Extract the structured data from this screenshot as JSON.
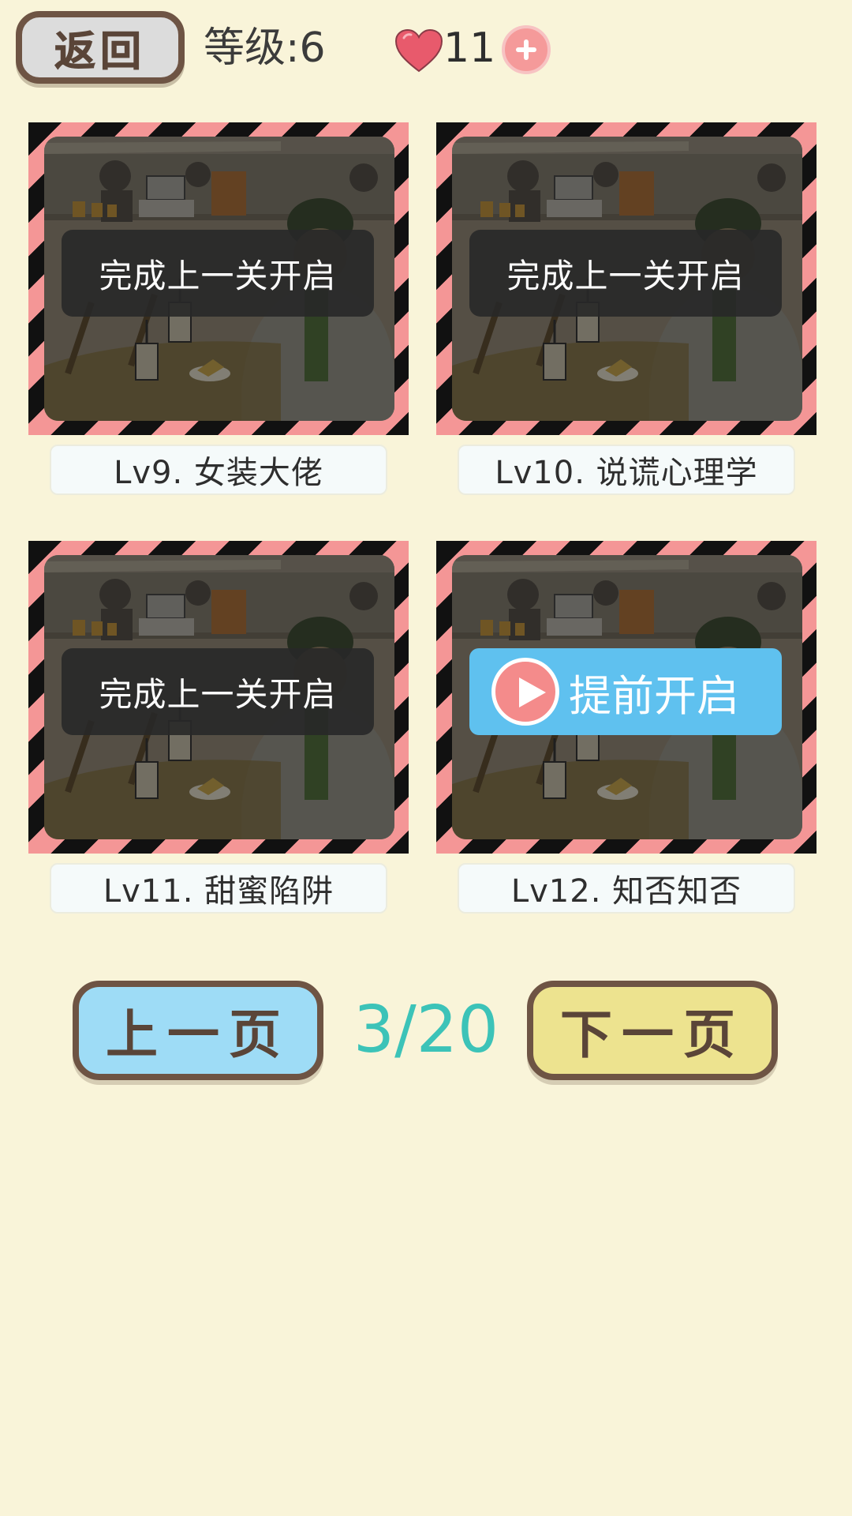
{
  "header": {
    "back_label": "返回",
    "level_text": "等级:6",
    "hearts_count": "11"
  },
  "cards": [
    {
      "name": "Lv9. 女装大佬",
      "locked_text": "完成上一关开启"
    },
    {
      "name": "Lv10. 说谎心理学",
      "locked_text": "完成上一关开启"
    },
    {
      "name": "Lv11. 甜蜜陷阱",
      "locked_text": "完成上一关开启"
    },
    {
      "name": "Lv12. 知否知否",
      "unlock_text": "提前开启"
    }
  ],
  "pager": {
    "prev_label": "上一页",
    "next_label": "下一页",
    "indicator": "3/20"
  },
  "colors": {
    "background": "#f9f4d9",
    "stripe_dark": "#111111",
    "stripe_pink": "#f49696",
    "unlock_blue": "#5fc1ef",
    "page_teal": "#3cc3b8",
    "prev_blue": "#9edcf6",
    "next_yellow": "#ede38f"
  }
}
